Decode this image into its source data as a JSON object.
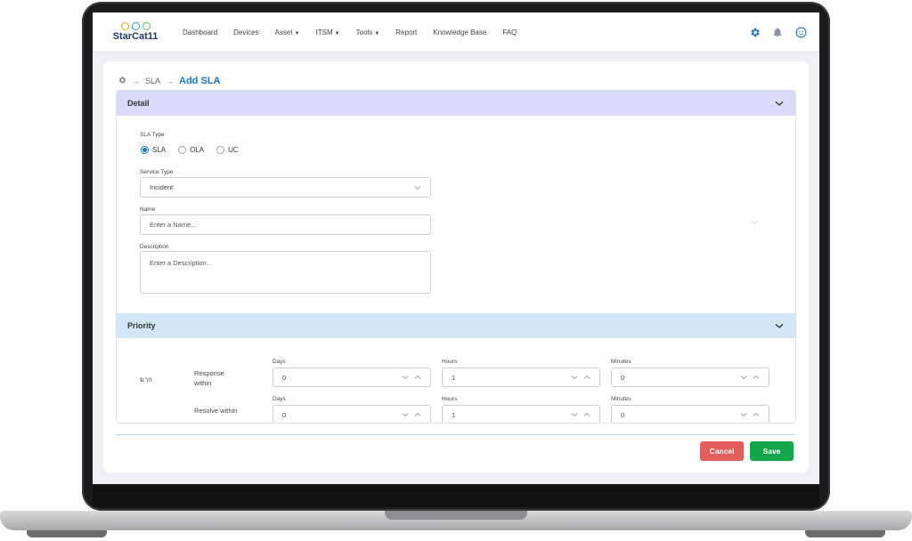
{
  "app": {
    "logo_text": "StarCat11",
    "logo_dots": [
      "#e3a21a",
      "#2b9fd8",
      "#5cb85c"
    ]
  },
  "nav": {
    "items": [
      {
        "label": "Dashboard",
        "caret": false
      },
      {
        "label": "Devices",
        "caret": false
      },
      {
        "label": "Asset",
        "caret": true
      },
      {
        "label": "ITSM",
        "caret": true
      },
      {
        "label": "Tools",
        "caret": true
      },
      {
        "label": "Report",
        "caret": false
      },
      {
        "label": "Knowledge Base",
        "caret": false
      },
      {
        "label": "FAQ",
        "caret": false
      }
    ],
    "icons": [
      "gear-icon",
      "bell-icon",
      "user-icon"
    ]
  },
  "breadcrumb": {
    "root_icon": "gear-icon",
    "parent": "SLA",
    "current": "Add SLA"
  },
  "detail": {
    "title": "Detail",
    "sla_type_label": "SLA Type",
    "sla_type_options": [
      "SLA",
      "OLA",
      "UC"
    ],
    "sla_type_selected": "SLA",
    "service_type_label": "Service Type",
    "service_type_value": "Incident",
    "name_label": "Name",
    "name_placeholder": "Enter a Name...",
    "description_label": "Description",
    "description_placeholder": "Enter a Description..."
  },
  "priority": {
    "title": "Priority",
    "level": "มาก",
    "response_label": "Response within",
    "resolve_label": "Resolve within",
    "days_label": "Days",
    "hours_label": "Hours",
    "minutes_label": "Minutes",
    "response": {
      "days": "0",
      "hours": "1",
      "minutes": "0"
    },
    "resolve": {
      "days": "0",
      "hours": "1",
      "minutes": "0"
    }
  },
  "actions": {
    "cancel": "Cancel",
    "save": "Save"
  },
  "colors": {
    "accent": "#1d76c3",
    "detail_header": "#d9d9fa",
    "priority_header": "#d3e6f5",
    "cancel": "#e35d5d",
    "save": "#13a54a"
  }
}
